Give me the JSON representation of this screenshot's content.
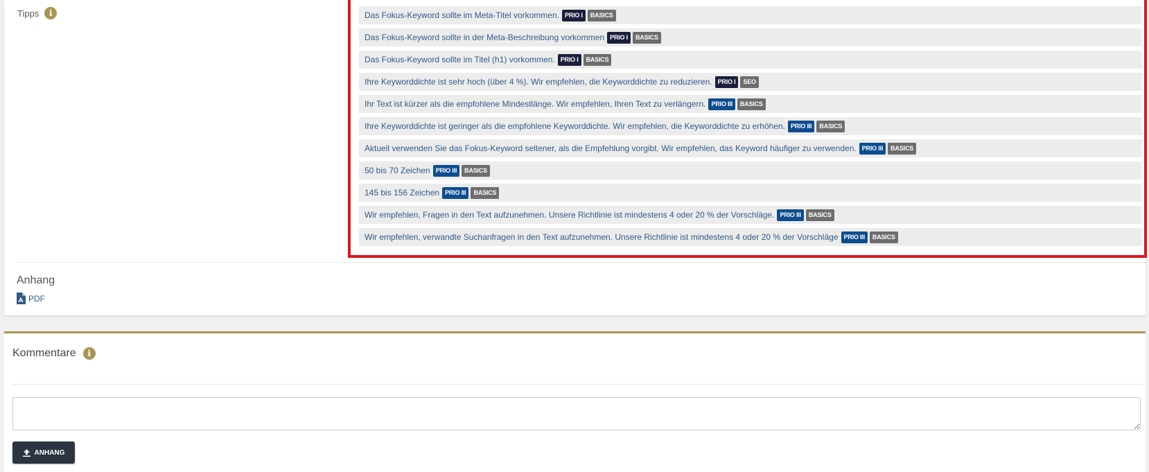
{
  "tipps": {
    "label": "Tipps",
    "info_icon": "i",
    "items": [
      {
        "text": "Das Fokus-Keyword sollte im Meta-Titel vorkommen.",
        "prio": "PRIO I",
        "prio_level": 1,
        "category": "BASICS"
      },
      {
        "text": "Das Fokus-Keyword sollte in der Meta-Beschreibung vorkommen",
        "prio": "PRIO I",
        "prio_level": 1,
        "category": "BASICS"
      },
      {
        "text": "Das Fokus-Keyword sollte im Titel (h1) vorkommen.",
        "prio": "PRIO I",
        "prio_level": 1,
        "category": "BASICS"
      },
      {
        "text": "Ihre Keyworddichte ist sehr hoch (über 4 %). Wir empfehlen, die Keyworddichte zu reduzieren.",
        "prio": "PRIO I",
        "prio_level": 1,
        "category": "SEO"
      },
      {
        "text": "Ihr Text ist kürzer als die empfohlene Mindestlänge. Wir empfehlen, Ihren Text zu verlängern.",
        "prio": "PRIO III",
        "prio_level": 3,
        "category": "BASICS"
      },
      {
        "text": "Ihre Keyworddichte ist geringer als die empfohlene Keyworddichte. Wir empfehlen, die Keyworddichte zu erhöhen.",
        "prio": "PRIO III",
        "prio_level": 3,
        "category": "BASICS"
      },
      {
        "text": "Aktuell verwenden Sie das Fokus-Keyword seltener, als die Empfehlung vorgibt. Wir empfehlen, das Keyword häufiger zu verwenden.",
        "prio": "PRIO III",
        "prio_level": 3,
        "category": "BASICS"
      },
      {
        "text": "50 bis 70 Zeichen",
        "prio": "PRIO III",
        "prio_level": 3,
        "category": "BASICS"
      },
      {
        "text": "145 bis 156 Zeichen",
        "prio": "PRIO III",
        "prio_level": 3,
        "category": "BASICS"
      },
      {
        "text": "Wir empfehlen, Fragen in den Text aufzunehmen. Unsere Richtlinie ist mindestens 4 oder 20 % der Vorschläge.",
        "prio": "PRIO III",
        "prio_level": 3,
        "category": "BASICS"
      },
      {
        "text": "Wir empfehlen, verwandte Suchanfragen in den Text aufzunehmen. Unsere Richtlinie ist mindestens 4 oder 20 % der Vorschläge",
        "prio": "PRIO III",
        "prio_level": 3,
        "category": "BASICS"
      }
    ]
  },
  "anhang": {
    "title": "Anhang",
    "pdf_label": "PDF",
    "pdf_icon": "file-pdf-icon"
  },
  "kommentare": {
    "title": "Kommentare",
    "info_icon": "i",
    "comment_value": "",
    "button_label": "ANHANG",
    "button_icon": "upload-icon"
  },
  "colors": {
    "highlight": "#e0151c",
    "accent": "#a89553",
    "prio1": "#1b1f3b",
    "prio3": "#0d4d8f",
    "category": "#6d6d6d",
    "tip_text": "#2f5a88"
  }
}
